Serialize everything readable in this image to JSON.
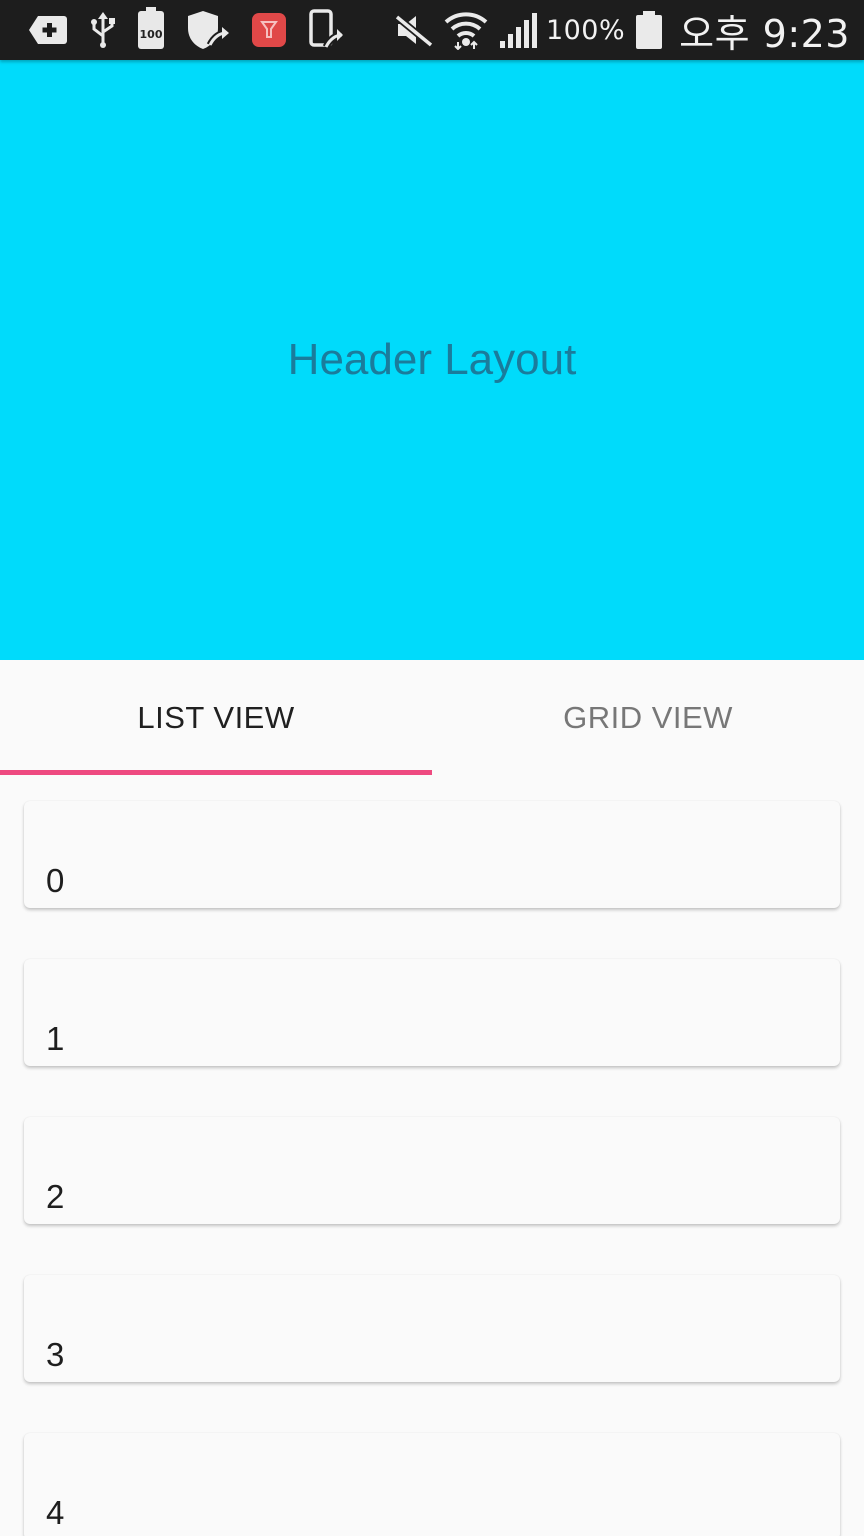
{
  "status_bar": {
    "icons_left": [
      "add-icon",
      "usb-icon",
      "battery-100-badge-icon",
      "shield-icon",
      "red-app-icon",
      "phone-sync-icon"
    ],
    "badge_text": "100",
    "battery_percent": "100%",
    "time": "오후 9:23"
  },
  "header": {
    "title": "Header Layout",
    "background": "#00dbfb",
    "text_color": "#1a7c9c"
  },
  "tabs": [
    {
      "label": "LIST VIEW",
      "active": true
    },
    {
      "label": "GRID VIEW",
      "active": false
    }
  ],
  "accent_color": "#ee4a80",
  "list": {
    "items": [
      "0",
      "1",
      "2",
      "3",
      "4"
    ]
  }
}
